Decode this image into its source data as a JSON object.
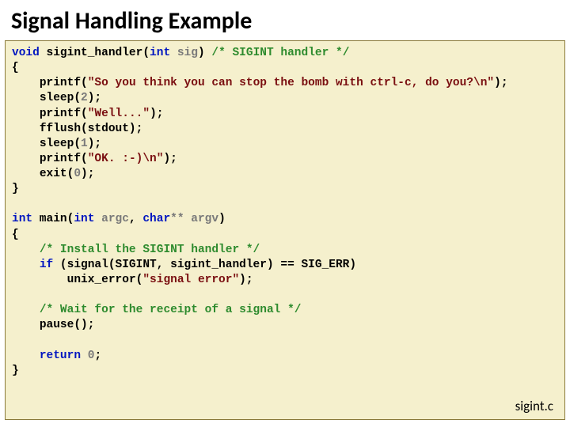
{
  "title": "Signal Handling Example",
  "filename": "sigint.c",
  "code": {
    "l1": {
      "kw1": "void",
      "fn": " sigint_handler",
      "p1": "(",
      "kw2": "int",
      "arg": " sig",
      "p2": ") ",
      "cmt": "/* SIGINT handler */"
    },
    "l2": "{",
    "l3": {
      "indent": "    ",
      "fn": "printf(",
      "str": "\"So you think you can stop the bomb with ctrl-c, do you?\\n\"",
      "p": ");"
    },
    "l4": {
      "indent": "    ",
      "fn": "sleep(",
      "arg": "2",
      "p": ");"
    },
    "l5": {
      "indent": "    ",
      "fn": "printf(",
      "str": "\"Well...\"",
      "p": ");"
    },
    "l6": {
      "indent": "    ",
      "fn": "fflush(stdout);"
    },
    "l7": {
      "indent": "    ",
      "fn": "sleep(",
      "arg": "1",
      "p": ");"
    },
    "l8": {
      "indent": "    ",
      "fn": "printf(",
      "str": "\"OK. :-)\\n\"",
      "p": ");"
    },
    "l9": {
      "indent": "    ",
      "fn": "exit(",
      "arg": "0",
      "p": ");"
    },
    "l10": "}",
    "l11": "",
    "l12": {
      "kw1": "int",
      "fn": " main",
      "p1": "(",
      "kw2": "int",
      "arg1": " argc",
      "c": ", ",
      "kw3": "char",
      "arg2": "** argv",
      "p2": ")"
    },
    "l13": "{",
    "l14": {
      "indent": "    ",
      "cmt": "/* Install the SIGINT handler */"
    },
    "l15": {
      "indent": "    ",
      "kw": "if ",
      "p1": "(signal(SIGINT, sigint_handler) == SIG_ERR)"
    },
    "l16": {
      "indent": "        ",
      "fn": "unix_error(",
      "str": "\"signal error\"",
      "p": ");"
    },
    "l17": "",
    "l18": {
      "indent": "    ",
      "cmt": "/* Wait for the receipt of a signal */"
    },
    "l19": {
      "indent": "    ",
      "fn": "pause();"
    },
    "l20": "",
    "l21": {
      "indent": "    ",
      "kw": "return ",
      "arg": "0",
      "p": ";"
    },
    "l22": "} "
  }
}
